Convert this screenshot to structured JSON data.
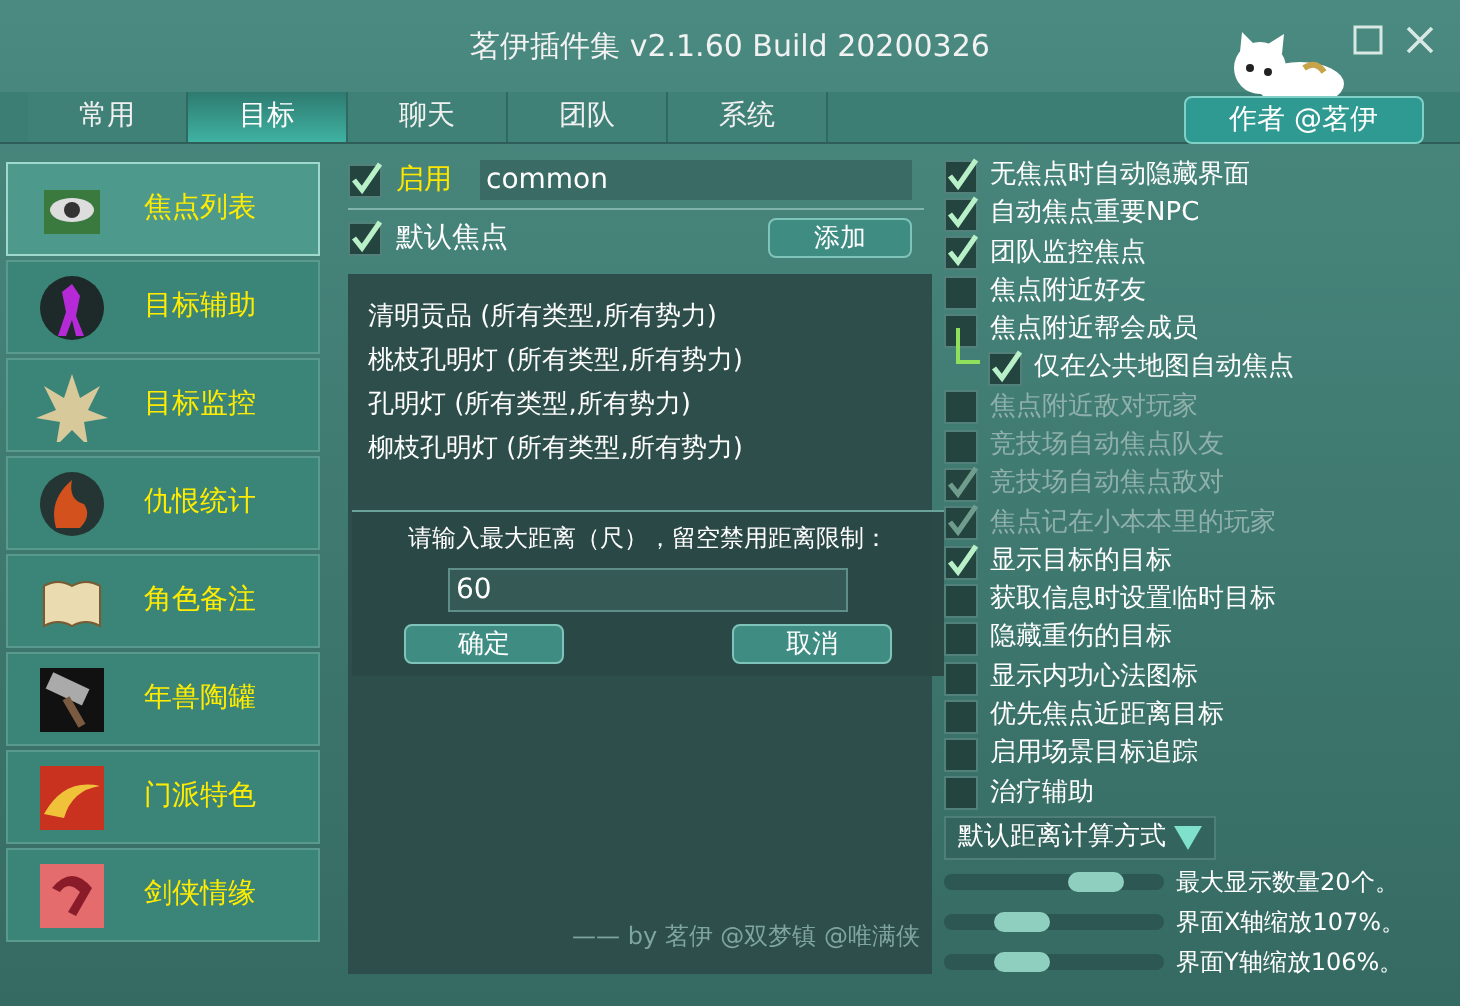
{
  "window": {
    "title": "茗伊插件集 v2.1.60 Build 20200326"
  },
  "tabs": [
    {
      "label": "常用",
      "selected": false
    },
    {
      "label": "目标",
      "selected": true
    },
    {
      "label": "聊天",
      "selected": false
    },
    {
      "label": "团队",
      "selected": false
    },
    {
      "label": "系统",
      "selected": false
    }
  ],
  "author_button": "作者 @茗伊",
  "sidebar": {
    "items": [
      {
        "label": "焦点列表",
        "selected": true,
        "kind": "eye"
      },
      {
        "label": "目标辅助",
        "selected": false,
        "kind": "figure"
      },
      {
        "label": "目标监控",
        "selected": false,
        "kind": "spikes"
      },
      {
        "label": "仇恨统计",
        "selected": false,
        "kind": "fire"
      },
      {
        "label": "角色备注",
        "selected": false,
        "kind": "book"
      },
      {
        "label": "年兽陶罐",
        "selected": false,
        "kind": "hammer"
      },
      {
        "label": "门派特色",
        "selected": false,
        "kind": "flame"
      },
      {
        "label": "剑侠情缘",
        "selected": false,
        "kind": "ribbon"
      }
    ]
  },
  "enable": {
    "label": "启用",
    "checked": true,
    "value": "common"
  },
  "default_focus": {
    "label": "默认焦点",
    "checked": true
  },
  "add_button": "添加",
  "focus_list": [
    "清明贡品 (所有类型,所有势力)",
    "桃枝孔明灯 (所有类型,所有势力)",
    "孔明灯 (所有类型,所有势力)",
    "柳枝孔明灯 (所有类型,所有势力)"
  ],
  "dialog": {
    "prompt": "请输入最大距离（尺），留空禁用距离限制：",
    "value": "60",
    "buttons": [
      "确定",
      "取消"
    ]
  },
  "credit": "—— by 茗伊 @双梦镇 @唯满侠",
  "options": [
    {
      "label": "无焦点时自动隐藏界面",
      "checked": true,
      "disabled": false
    },
    {
      "label": "自动焦点重要NPC",
      "checked": true,
      "disabled": false
    },
    {
      "label": "团队监控焦点",
      "checked": true,
      "disabled": false
    },
    {
      "label": "焦点附近好友",
      "checked": false,
      "disabled": false
    },
    {
      "label": "焦点附近帮会成员",
      "checked": false,
      "disabled": false,
      "children": [
        {
          "label": "仅在公共地图自动焦点",
          "checked": true,
          "disabled": false
        }
      ]
    },
    {
      "label": "焦点附近敌对玩家",
      "checked": false,
      "disabled": true
    },
    {
      "label": "竞技场自动焦点队友",
      "checked": false,
      "disabled": true
    },
    {
      "label": "竞技场自动焦点敌对",
      "checked": true,
      "disabled": true
    },
    {
      "label": "焦点记在小本本里的玩家",
      "checked": true,
      "disabled": true
    },
    {
      "label": "显示目标的目标",
      "checked": true,
      "disabled": false
    },
    {
      "label": "获取信息时设置临时目标",
      "checked": false,
      "disabled": false
    },
    {
      "label": "隐藏重伤的目标",
      "checked": false,
      "disabled": false
    },
    {
      "label": "显示内功心法图标",
      "checked": false,
      "disabled": false
    },
    {
      "label": "优先焦点近距离目标",
      "checked": false,
      "disabled": false
    },
    {
      "label": "启用场景目标追踪",
      "checked": false,
      "disabled": false
    },
    {
      "label": "治疗辅助",
      "checked": false,
      "disabled": false
    }
  ],
  "distance_dropdown": "默认距离计算方式",
  "sliders": [
    {
      "label": "最大显示数量20个。",
      "level": 0.76
    },
    {
      "label": "界面X轴缩放107%。",
      "level": 0.3
    },
    {
      "label": "界面Y轴缩放106%。",
      "level": 0.3
    }
  ]
}
